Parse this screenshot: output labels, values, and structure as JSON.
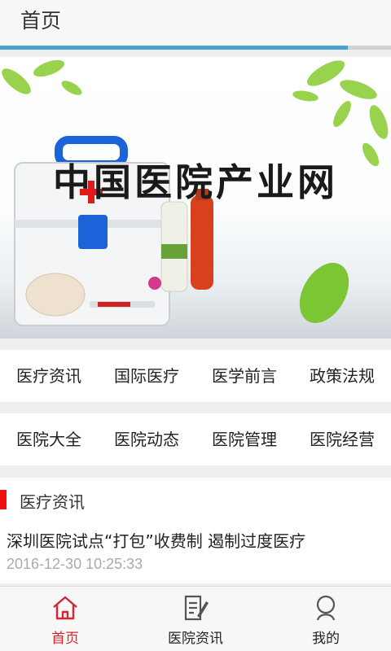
{
  "header": {
    "title": "首页",
    "load_progress": 0.89
  },
  "banner": {
    "title": "中国医院产业网",
    "slide_count": 2,
    "active_slide": 0,
    "colors": {
      "dot_active": "#ee3311",
      "dot_inactive": "#555555"
    }
  },
  "categories": {
    "row1": [
      "医疗资讯",
      "国际医疗",
      "医学前言",
      "政策法规"
    ],
    "row2": [
      "医院大全",
      "医院动态",
      "医院管理",
      "医院经营"
    ]
  },
  "news": {
    "section_title": "医疗资讯",
    "items": [
      {
        "title": "深圳医院试点“打包”收费制 遏制过度医疗",
        "time": "2016-12-30 10:25:33"
      }
    ]
  },
  "tabbar": {
    "items": [
      {
        "label": "首页",
        "icon": "home-icon",
        "active": true
      },
      {
        "label": "医院资讯",
        "icon": "document-edit-icon",
        "active": false
      },
      {
        "label": "我的",
        "icon": "user-icon",
        "active": false
      }
    ],
    "colors": {
      "active": "#d7262d",
      "inactive": "#555555"
    }
  }
}
